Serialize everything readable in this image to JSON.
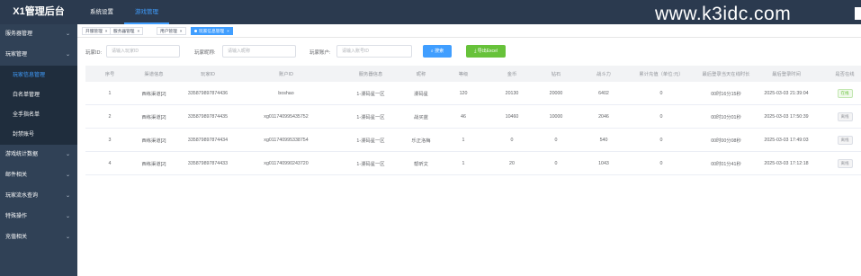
{
  "app": {
    "title": "X1管理后台"
  },
  "topnav": [
    "系统设置",
    "游戏管理"
  ],
  "watermark": "www.k3idc.com",
  "sidebar": [
    {
      "type": "group",
      "label": "服务器管理"
    },
    {
      "type": "group",
      "label": "玩家管理"
    },
    {
      "type": "sub",
      "label": "玩家信息管理",
      "active": true
    },
    {
      "type": "sub",
      "label": "白名单管理"
    },
    {
      "type": "sub",
      "label": "全手指名单"
    },
    {
      "type": "sub",
      "label": "封禁账号"
    },
    {
      "type": "group",
      "label": "游戏统计数据"
    },
    {
      "type": "group",
      "label": "邮件相关"
    },
    {
      "type": "group",
      "label": "玩家流水查询"
    },
    {
      "type": "group",
      "label": "特殊操作"
    },
    {
      "type": "group",
      "label": "充值相关"
    }
  ],
  "tags": [
    {
      "label": "开服管理",
      "close": "×"
    },
    {
      "label": "服务器管理",
      "close": "×"
    },
    {
      "label": "用户管理",
      "close": "×"
    },
    {
      "label": "玩家信息管理",
      "close": "×",
      "active": true
    }
  ],
  "filter": {
    "player_id_label": "玩家ID:",
    "player_id_placeholder": "请输入玩家ID",
    "nickname_label": "玩家昵称:",
    "nickname_placeholder": "请输入昵称",
    "account_label": "玩家账户:",
    "account_placeholder": "请输入账号ID",
    "search_label": "搜索",
    "export_label": "导出Excel"
  },
  "table": {
    "headers": [
      "序号",
      "渠道信息",
      "玩家ID",
      "账户ID",
      "服务器信息",
      "昵称",
      "等级",
      "金币",
      "钻石",
      "战斗力",
      "累计充值（单位:元）",
      "最后登录当天在线时长",
      "最后登录时间",
      "是否在线"
    ],
    "rows": [
      [
        "1",
        "西练渠道[2]",
        "335879897874436",
        "boshao",
        "1-漫码星一区",
        "漫码星",
        "120",
        "20130",
        "20000",
        "6402",
        "0",
        "00时16分15秒",
        "2025-03-03 21:39:04",
        "在线"
      ],
      [
        "2",
        "西练渠道[2]",
        "335879897874435",
        "xg011740995435752",
        "1-漫码星一区",
        "战买蓝",
        "46",
        "10460",
        "10000",
        "2046",
        "0",
        "00时10分01秒",
        "2025-03-03 17:50:39",
        "离线"
      ],
      [
        "3",
        "西练渠道[2]",
        "335879897874434",
        "xg011740995338754",
        "1-漫码星一区",
        "乐正洛梅",
        "1",
        "0",
        "0",
        "540",
        "0",
        "00时00分08秒",
        "2025-03-03 17:49:03",
        "离线"
      ],
      [
        "4",
        "西练渠道[2]",
        "335879897874433",
        "xg011740990243720",
        "1-漫码星一区",
        "帮昕文",
        "1",
        "20",
        "0",
        "1043",
        "0",
        "00时01分41秒",
        "2025-03-03 17:12:18",
        "离线"
      ]
    ]
  },
  "colors": {
    "topbar": "#2b3a4f",
    "sidebar": "#304156",
    "primary": "#409eff",
    "success": "#67c23a"
  }
}
